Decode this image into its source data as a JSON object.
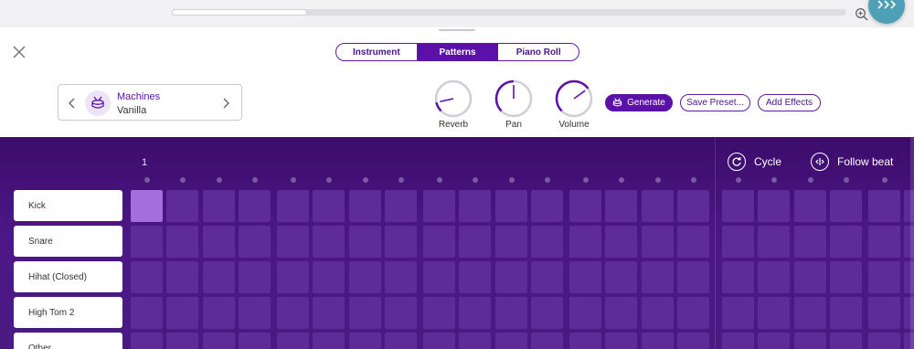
{
  "tabs": [
    {
      "label": "Instrument",
      "active": false
    },
    {
      "label": "Patterns",
      "active": true
    },
    {
      "label": "Piano Roll",
      "active": false
    }
  ],
  "instrument": {
    "name": "Machines",
    "preset": "Vanilla",
    "icon": "drum-icon"
  },
  "knobs": [
    {
      "label": "Reverb",
      "level": 0.12
    },
    {
      "label": "Pan",
      "level": 0.5
    },
    {
      "label": "Volume",
      "level": 0.7
    }
  ],
  "buttons": {
    "generate": "Generate",
    "save_preset": "Save Preset...",
    "add_effects": "Add Effects"
  },
  "sequencer": {
    "bar_number": "1",
    "cycle_label": "Cycle",
    "follow_beat_label": "Follow beat",
    "tracks": [
      "Kick",
      "Snare",
      "Hihat (Closed)",
      "High Tom 2",
      "Other"
    ],
    "active_steps": [
      [
        0
      ],
      [],
      [],
      [],
      []
    ]
  },
  "colors": {
    "accent": "#5b10a8",
    "grid_bg": "#4b1786",
    "cell_off": "#5e2c98",
    "cell_on": "#a46fdc",
    "fab": "#4fa0b6"
  }
}
